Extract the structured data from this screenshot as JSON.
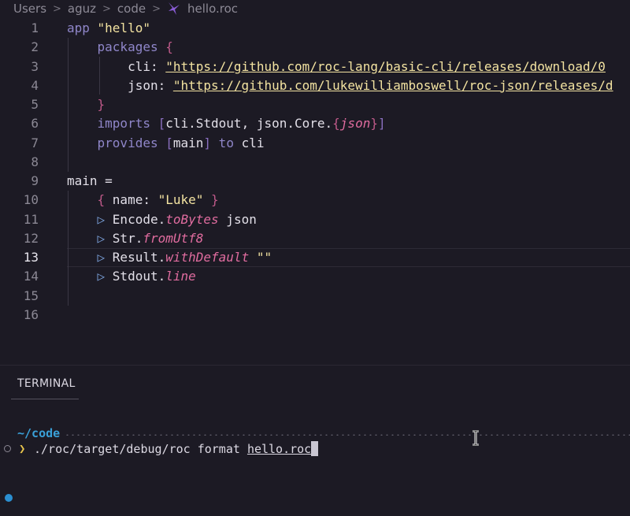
{
  "breadcrumb": {
    "items": [
      "Users",
      "aguz",
      "code"
    ],
    "file": "hello.roc",
    "icon": "roc-logo-icon"
  },
  "editor": {
    "active_line": 13,
    "lines": [
      {
        "n": "1",
        "tokens": [
          [
            "kw",
            "app "
          ],
          [
            "str",
            "\"hello\""
          ]
        ]
      },
      {
        "n": "2",
        "tokens": [
          [
            "kw",
            "    packages "
          ],
          [
            "br1",
            "{"
          ]
        ]
      },
      {
        "n": "3",
        "tokens": [
          [
            "plain",
            "        cli: "
          ],
          [
            "url",
            "\"https://github.com/roc-lang/basic-cli/releases/download/0"
          ]
        ]
      },
      {
        "n": "4",
        "tokens": [
          [
            "plain",
            "        json: "
          ],
          [
            "url",
            "\"https://github.com/lukewilliamboswell/roc-json/releases/d"
          ]
        ]
      },
      {
        "n": "5",
        "tokens": [
          [
            "br1",
            "    }"
          ]
        ]
      },
      {
        "n": "6",
        "tokens": [
          [
            "kw",
            "    imports "
          ],
          [
            "br2",
            "["
          ],
          [
            "plain",
            "cli.Stdout, json.Core."
          ],
          [
            "br1",
            "{"
          ],
          [
            "fn",
            "json"
          ],
          [
            "br1",
            "}"
          ],
          [
            "br2",
            "]"
          ]
        ]
      },
      {
        "n": "7",
        "tokens": [
          [
            "kw",
            "    provides "
          ],
          [
            "br2",
            "["
          ],
          [
            "plain",
            "main"
          ],
          [
            "br2",
            "]"
          ],
          [
            "kw",
            " to "
          ],
          [
            "plain",
            "cli"
          ]
        ]
      },
      {
        "n": "8",
        "tokens": []
      },
      {
        "n": "9",
        "tokens": [
          [
            "plain",
            "main ="
          ]
        ]
      },
      {
        "n": "10",
        "tokens": [
          [
            "br1",
            "    { "
          ],
          [
            "plain",
            "name: "
          ],
          [
            "str",
            "\"Luke\""
          ],
          [
            "br1",
            " }"
          ]
        ]
      },
      {
        "n": "11",
        "tokens": [
          [
            "pipe",
            "    ▷ "
          ],
          [
            "plain",
            "Encode."
          ],
          [
            "fn",
            "toBytes"
          ],
          [
            "plain",
            " json"
          ]
        ]
      },
      {
        "n": "12",
        "tokens": [
          [
            "pipe",
            "    ▷ "
          ],
          [
            "plain",
            "Str."
          ],
          [
            "fn",
            "fromUtf8"
          ]
        ]
      },
      {
        "n": "13",
        "tokens": [
          [
            "pipe",
            "    ▷ "
          ],
          [
            "plain",
            "Result."
          ],
          [
            "fn",
            "withDefault"
          ],
          [
            "str",
            " \"\""
          ]
        ]
      },
      {
        "n": "14",
        "tokens": [
          [
            "pipe",
            "    ▷ "
          ],
          [
            "plain",
            "Stdout."
          ],
          [
            "fn",
            "line"
          ]
        ]
      },
      {
        "n": "15",
        "tokens": []
      },
      {
        "n": "16",
        "tokens": []
      }
    ]
  },
  "terminal": {
    "tab_label": "TERMINAL",
    "prompt_path": "~/code",
    "prompt_symbol": "❯",
    "command_prefix": "./roc/target/debug/roc format ",
    "command_arg": "hello.roc"
  },
  "colors": {
    "background": "#1c1a24",
    "keyword": "#8f86c9",
    "string": "#f3e3a1",
    "function": "#e06c9f",
    "prompt_path": "#3aa0d8",
    "prompt_symbol": "#e8c44c"
  }
}
